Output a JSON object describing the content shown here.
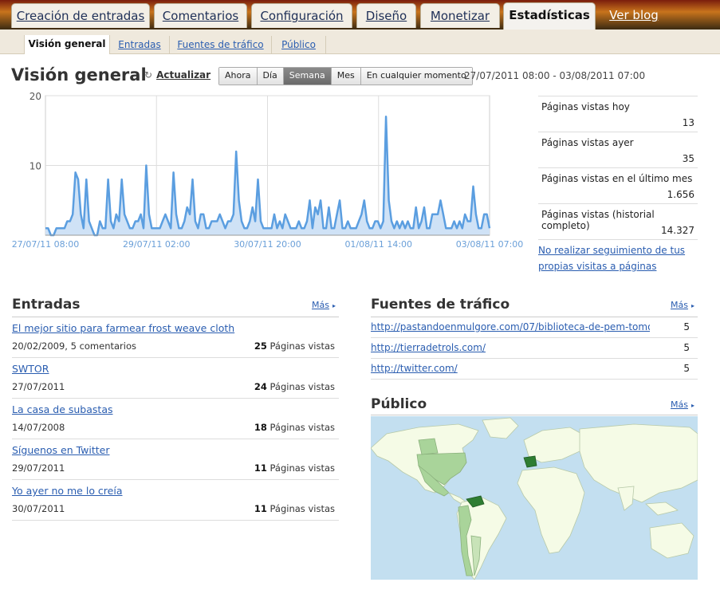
{
  "tabs": [
    {
      "label": "Creación de entradas"
    },
    {
      "label": "Comentarios"
    },
    {
      "label": "Configuración"
    },
    {
      "label": "Diseño"
    },
    {
      "label": "Monetizar"
    },
    {
      "label": "Estadísticas"
    },
    {
      "label": "Ver blog"
    }
  ],
  "subtabs": [
    {
      "label": "Visión general"
    },
    {
      "label": "Entradas"
    },
    {
      "label": "Fuentes de tráfico"
    },
    {
      "label": "Público"
    }
  ],
  "overview": {
    "title": "Visión general",
    "refresh_label": "Actualizar",
    "refresh_icon": "refresh-icon",
    "ranges": [
      "Ahora",
      "Día",
      "Semana",
      "Mes",
      "En cualquier momento"
    ],
    "selected_range": "Semana",
    "date_range": "27/07/2011 08:00 - 03/08/2011 07:00"
  },
  "chart_data": {
    "type": "area",
    "title": "",
    "xlabel": "",
    "ylabel": "",
    "ylim": [
      0,
      20
    ],
    "yticks": [
      10,
      20
    ],
    "xtick_labels": [
      "27/07/11 08:00",
      "29/07/11 02:00",
      "30/07/11 20:00",
      "01/08/11 14:00",
      "03/08/11 07:00"
    ],
    "grid": true,
    "series": [
      {
        "values": [
          1,
          1,
          0,
          0,
          1,
          1,
          1,
          1,
          2,
          2,
          3,
          9,
          8,
          3,
          1,
          8,
          2,
          1,
          0,
          0,
          2,
          1,
          1,
          8,
          2,
          1,
          3,
          2,
          8,
          3,
          2,
          1,
          1,
          2,
          2,
          3,
          1,
          10,
          3,
          1,
          1,
          1,
          1,
          2,
          3,
          2,
          1,
          9,
          3,
          1,
          1,
          2,
          4,
          3,
          8,
          2,
          1,
          3,
          3,
          1,
          1,
          2,
          2,
          2,
          3,
          2,
          1,
          2,
          2,
          3,
          12,
          5,
          2,
          1,
          1,
          2,
          4,
          2,
          8,
          2,
          1,
          1,
          1,
          1,
          3,
          1,
          2,
          1,
          3,
          2,
          1,
          1,
          1,
          2,
          1,
          1,
          2,
          5,
          1,
          4,
          3,
          5,
          1,
          1,
          4,
          1,
          1,
          3,
          5,
          1,
          1,
          2,
          1,
          1,
          1,
          2,
          3,
          5,
          2,
          1,
          1,
          2,
          2,
          1,
          2,
          17,
          5,
          2,
          1,
          2,
          1,
          2,
          1,
          2,
          1,
          1,
          4,
          1,
          2,
          4,
          1,
          1,
          3,
          3,
          3,
          5,
          3,
          1,
          1,
          1,
          2,
          1,
          2,
          1,
          3,
          2,
          2,
          7,
          3,
          1,
          1,
          3,
          3,
          1
        ]
      }
    ]
  },
  "stats": [
    {
      "label": "Páginas vistas hoy",
      "value": "13"
    },
    {
      "label": "Páginas vistas ayer",
      "value": "35"
    },
    {
      "label": "Páginas vistas en el último mes",
      "value": "1.656"
    },
    {
      "label": "Páginas vistas (historial completo)",
      "value": "14.327"
    }
  ],
  "no_track": {
    "line1": "No realizar seguimiento de tus",
    "line2": "propias visitas a páginas"
  },
  "posts": {
    "title": "Entradas",
    "more": "Más",
    "items": [
      {
        "title": "El mejor sitio para farmear frost weave cloth",
        "meta": "20/02/2009, 5 comentarios",
        "count": "25",
        "unit": "Páginas vistas"
      },
      {
        "title": "SWTOR",
        "meta": "27/07/2011",
        "count": "24",
        "unit": "Páginas vistas"
      },
      {
        "title": "La casa de subastas",
        "meta": "14/07/2008",
        "count": "18",
        "unit": "Páginas vistas"
      },
      {
        "title": "Síguenos en Twitter",
        "meta": "29/07/2011",
        "count": "11",
        "unit": "Páginas vistas"
      },
      {
        "title": "Yo ayer no me lo creía",
        "meta": "30/07/2011",
        "count": "11",
        "unit": "Páginas vistas"
      }
    ]
  },
  "traffic": {
    "title": "Fuentes de tráfico",
    "more": "Más",
    "items": [
      {
        "url": "http://pastandoenmulgore.com/07/biblioteca-de-pem-tomo",
        "count": "5"
      },
      {
        "url": "http://tierradetrols.com/",
        "count": "5"
      },
      {
        "url": "http://twitter.com/",
        "count": "5"
      }
    ]
  },
  "audience": {
    "title": "Público",
    "more": "Más",
    "colors": {
      "water": "#c3dff0",
      "land": "#f5fbe6",
      "low": "#a9d49a",
      "high": "#2e7d32"
    }
  }
}
